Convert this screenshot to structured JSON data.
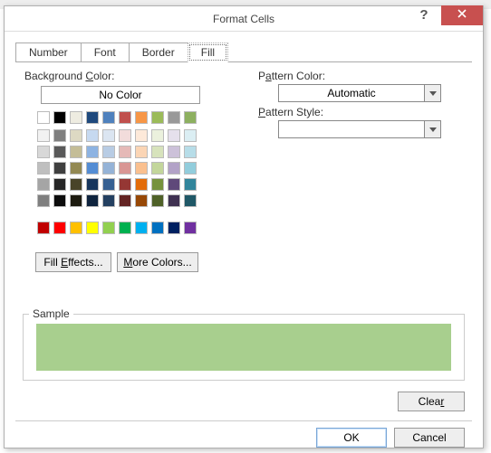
{
  "dialog": {
    "title": "Format Cells",
    "tabs": [
      "Number",
      "Font",
      "Border",
      "Fill"
    ],
    "active_tab": 3
  },
  "fill": {
    "bgcolor_label": "Background Color:",
    "nocolor_label": "No Color",
    "fill_effects_label": "Fill Effects...",
    "more_colors_label": "More Colors...",
    "pattern_color_label": "Pattern Color:",
    "pattern_color_value": "Automatic",
    "pattern_style_label": "Pattern Style:",
    "pattern_style_value": "",
    "sample_label": "Sample",
    "sample_color": "#a8cf8e",
    "selected_color": "#a8cf8e"
  },
  "palette": {
    "row1": [
      "#ffffff",
      "#000000",
      "#eeece1",
      "#1f497d",
      "#4f81bd",
      "#c0504d",
      "#f79646",
      "#9bbb59",
      "#999999",
      "#8db060"
    ],
    "theme": [
      [
        "#f2f2f2",
        "#7f7f7f",
        "#ddd9c3",
        "#c6d9f0",
        "#dbe5f1",
        "#f2dcdb",
        "#fde9d9",
        "#ebf1dd",
        "#e5e0ec",
        "#dbeef3"
      ],
      [
        "#d8d8d8",
        "#595959",
        "#c4bd97",
        "#8db3e2",
        "#b8cce4",
        "#e5b9b7",
        "#fbd5b5",
        "#d7e3bc",
        "#ccc1d9",
        "#b7dde8"
      ],
      [
        "#bfbfbf",
        "#3f3f3f",
        "#938953",
        "#548dd4",
        "#95b3d7",
        "#d99694",
        "#fac08f",
        "#c3d69b",
        "#b2a2c7",
        "#92cddc"
      ],
      [
        "#a5a5a5",
        "#262626",
        "#494429",
        "#17365d",
        "#366092",
        "#953734",
        "#e36c09",
        "#76923c",
        "#5f497a",
        "#31859b"
      ],
      [
        "#7f7f7f",
        "#0c0c0c",
        "#1d1b10",
        "#0f243e",
        "#244061",
        "#632423",
        "#974806",
        "#4f6128",
        "#3f3151",
        "#205867"
      ]
    ],
    "standard": [
      "#c00000",
      "#ff0000",
      "#ffc000",
      "#ffff00",
      "#92d050",
      "#00b050",
      "#00b0f0",
      "#0070c0",
      "#002060",
      "#7030a0"
    ]
  },
  "buttons": {
    "clear": "Clear",
    "ok": "OK",
    "cancel": "Cancel"
  }
}
